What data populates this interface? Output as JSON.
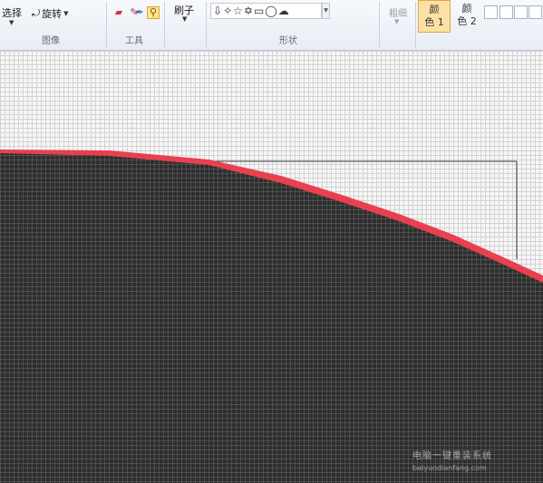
{
  "ribbon": {
    "image_group": {
      "label": "图像",
      "select_label": "选择",
      "rotate_label": "旋转"
    },
    "tools_group": {
      "label": "工具"
    },
    "brushes_label": "刷子",
    "shapes_group": {
      "label": "形状"
    },
    "size_label": "粗细",
    "colors": {
      "color1_label": "颜色 1",
      "color2_label": "颜色 2",
      "color1_line1": "颜",
      "color1_line2": "色 1",
      "color2_line1": "颜",
      "color2_line2": "色 2"
    }
  },
  "icons": {
    "pencil": "pencil-icon",
    "eraser": "eraser-icon",
    "color_picker": "color-picker-icon",
    "magnifier": "magnifier-icon",
    "rotate": "rotate-icon"
  },
  "canvas": {
    "grid_color": "#d3d3d3",
    "fill_color": "#2e2e2e",
    "edge_color": "#e8404f",
    "background_color": "#f6f6f6"
  },
  "watermark": {
    "line1": "电脑一键重装系统",
    "line2": "baiyundianfang.com"
  }
}
